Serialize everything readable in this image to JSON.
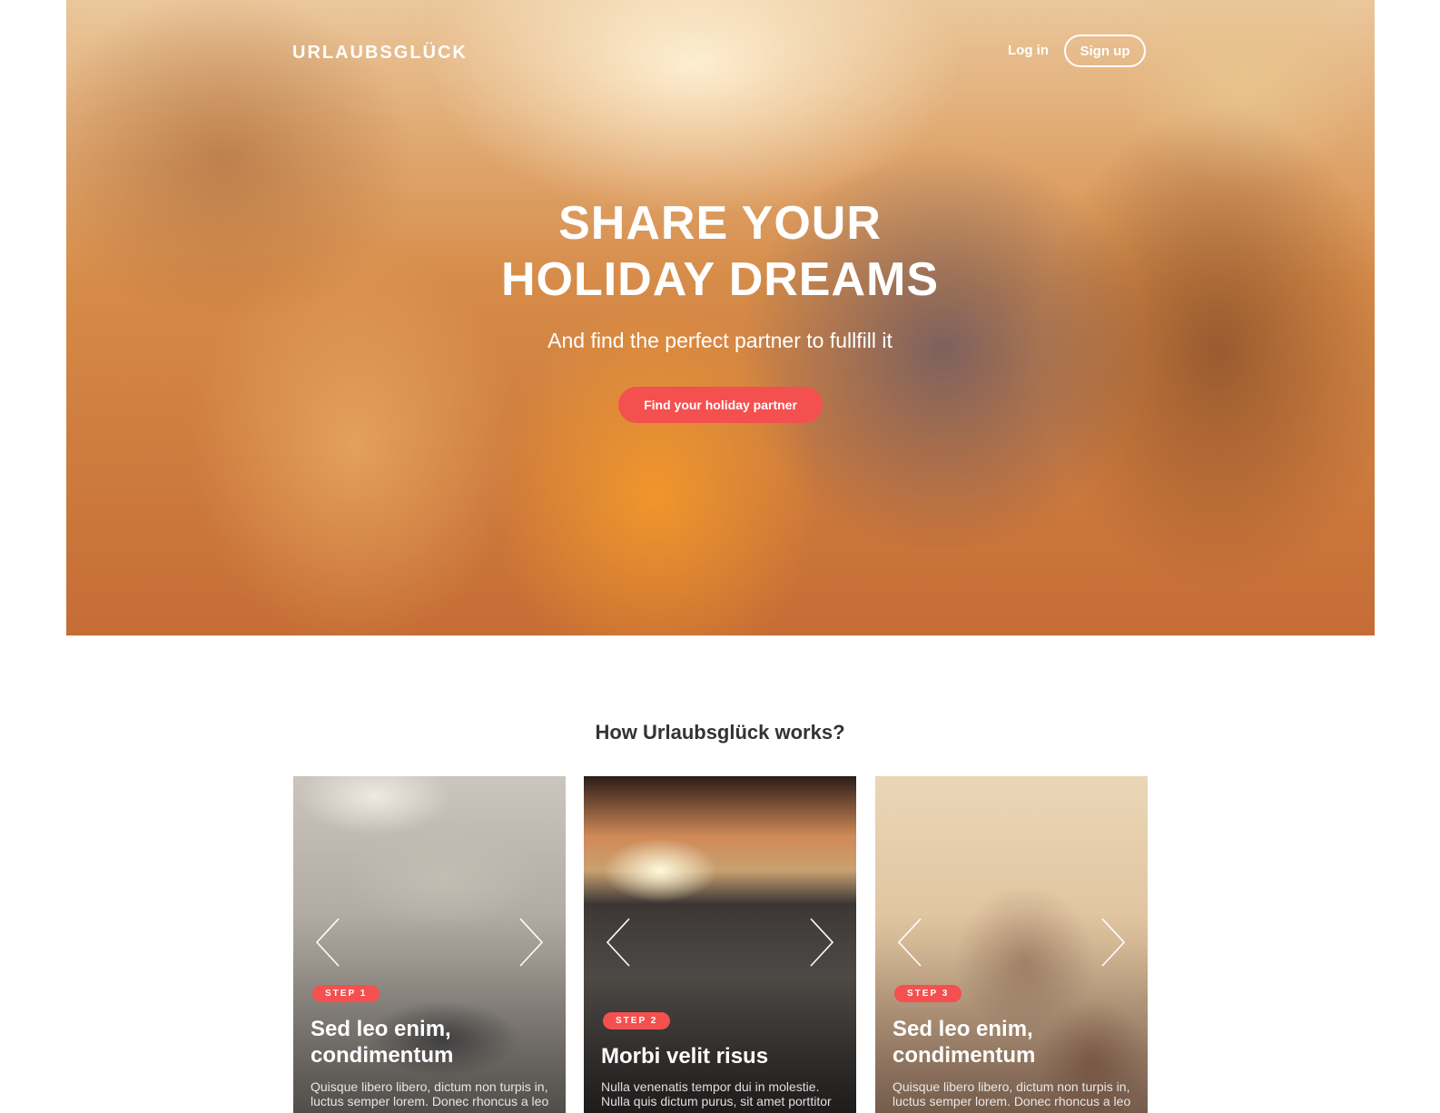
{
  "header": {
    "logo": "URLAUBSGLÜCK",
    "login_label": "Log in",
    "signup_label": "Sign up"
  },
  "hero": {
    "title_line1": "SHARE YOUR",
    "title_line2": "HOLIDAY DREAMS",
    "subtitle": "And find the perfect partner to fullfill it",
    "cta_label": "Find your holiday partner"
  },
  "how_it_works": {
    "title": "How Urlaubsglück works?",
    "cards": [
      {
        "badge": "STEP 1",
        "title": "Sed leo enim, condimentum",
        "text": "Quisque libero libero, dictum non turpis in, luctus semper lorem. Donec rhoncus a leo"
      },
      {
        "badge": "STEP 2",
        "title": "Morbi velit risus",
        "text": "Nulla venenatis tempor dui in molestie. Nulla quis dictum purus, sit amet porttitor"
      },
      {
        "badge": "STEP 3",
        "title": "Sed leo enim, condimentum",
        "text": "Quisque libero libero, dictum non turpis in, luctus semper lorem. Donec rhoncus a leo"
      }
    ]
  },
  "colors": {
    "accent": "#f4504f",
    "heading": "#333333",
    "background": "#ffffff"
  },
  "icons": [
    "chevron-left-icon",
    "chevron-right-icon"
  ]
}
